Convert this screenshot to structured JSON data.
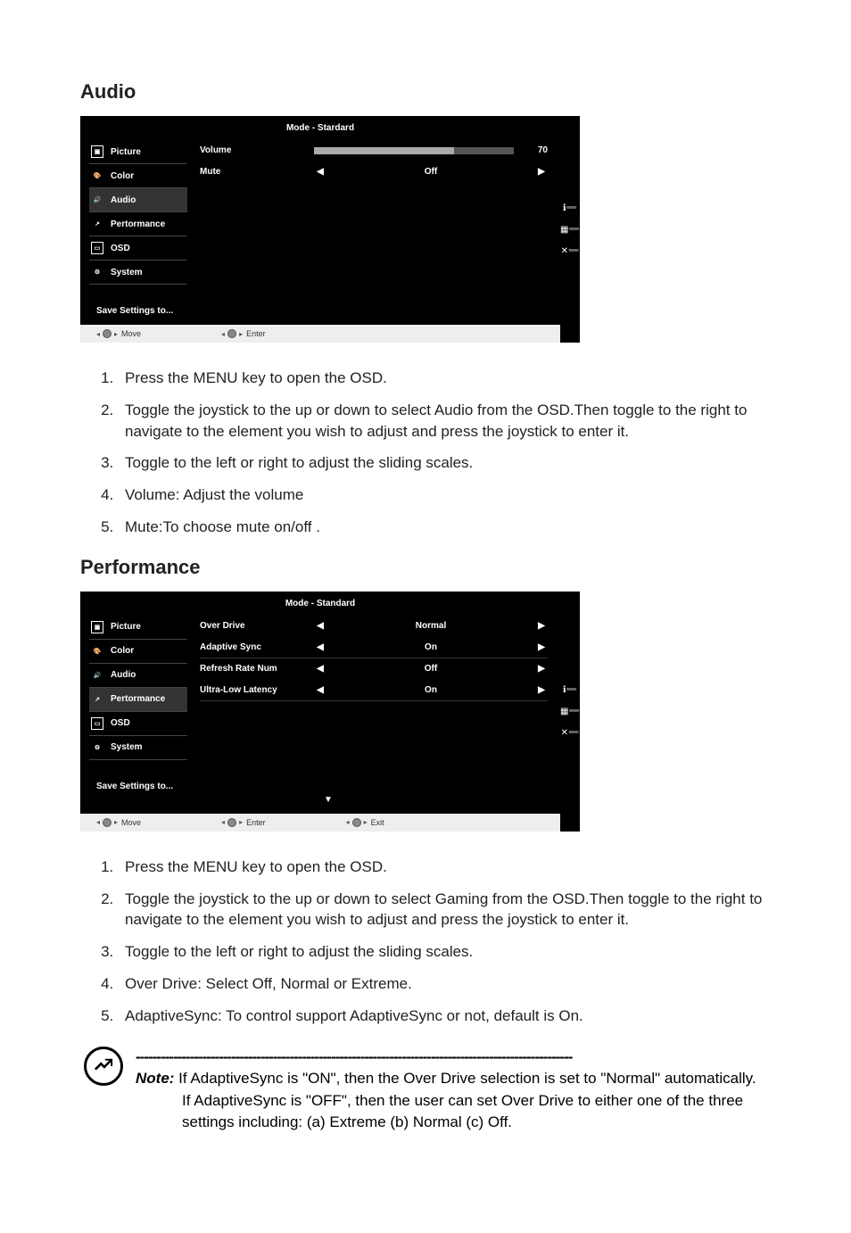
{
  "sections": {
    "audio": {
      "heading": "Audio",
      "osd": {
        "mode": "Mode - Stardard",
        "menu": [
          "Picture",
          "Color",
          "Audio",
          "Pertormance",
          "OSD",
          "System"
        ],
        "save": "Save Settings to...",
        "settings": {
          "volume": {
            "label": "Volume",
            "value": "70"
          },
          "mute": {
            "label": "Mute",
            "value": "Off"
          }
        },
        "hints": {
          "move": "Move",
          "enter": "Enter"
        }
      },
      "steps": [
        "Press the MENU key to open the OSD.",
        "Toggle the joystick to the up or down to select Audio from the OSD.Then toggle to the right to navigate to the element you wish to adjust and press the joystick to enter it.",
        "Toggle to the left or right to adjust the sliding scales.",
        "Volume: Adjust the volume",
        "Mute:To choose mute on/off ."
      ]
    },
    "performance": {
      "heading": "Performance",
      "osd": {
        "mode": "Mode - Standard",
        "menu": [
          "Picture",
          "Color",
          "Audio",
          "Pertormance",
          "OSD",
          "System"
        ],
        "save": "Save Settings to...",
        "settings": {
          "overdrive": {
            "label": "Over Drive",
            "value": "Normal"
          },
          "adaptivesync": {
            "label": "Adaptive Sync",
            "value": "On"
          },
          "refresh": {
            "label": "Refresh Rate Num",
            "value": "Off"
          },
          "ull": {
            "label": "Ultra-Low Latency",
            "value": "On"
          }
        },
        "hints": {
          "move": "Move",
          "enter": "Enter",
          "exit": "Exit"
        }
      },
      "steps": [
        "Press the MENU key to open the OSD.",
        "Toggle the joystick to the up or down to select Gaming from the OSD.Then toggle to the right to navigate to the element you wish to adjust and press the joystick to enter it.",
        "Toggle to the left or right to adjust the sliding scales.",
        "Over Drive: Select Off, Normal or Extreme.",
        "AdaptiveSync: To control support AdaptiveSync or not, default is On."
      ]
    }
  },
  "note": {
    "dashes": "---------------------------------------------------------------------------------------------------------",
    "label": "Note:",
    "line1": " If AdaptiveSync is \"ON\", then the Over Drive selection is set to \"Normal\" automatically.",
    "line2": "If AdaptiveSync is \"OFF\", then the user can set Over Drive to either one of the three settings including: (a) Extreme (b) Normal (c) Off."
  },
  "glyphs": {
    "left": "◀",
    "right": "▶",
    "down": "▼",
    "info": "ℹ",
    "grid": "⠿",
    "close": "✕"
  }
}
